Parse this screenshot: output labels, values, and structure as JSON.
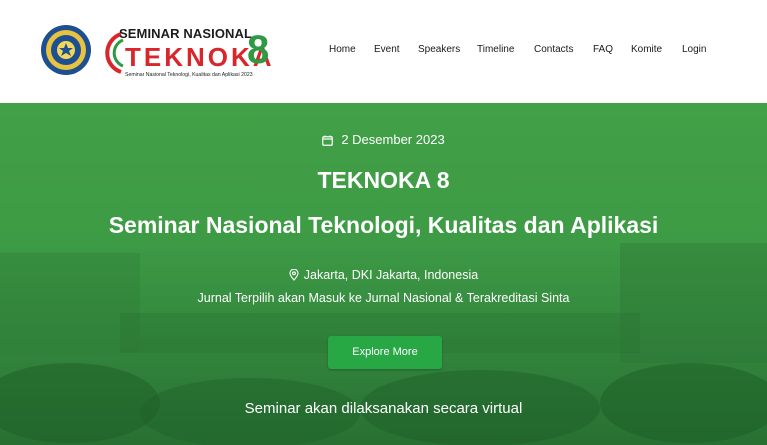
{
  "header": {
    "brand": {
      "top_text": "SEMINAR NASIONAL",
      "name": "TEKNOKA",
      "number": "8",
      "subtitle": "Seminar Nasional Teknologi, Kualitas dan Aplikasi 2023"
    },
    "nav": [
      {
        "label": "Home"
      },
      {
        "label": "Event"
      },
      {
        "label": "Speakers"
      },
      {
        "label": "Timeline"
      },
      {
        "label": "Contacts"
      },
      {
        "label": "FAQ"
      },
      {
        "label": "Komite"
      },
      {
        "label": "Login"
      }
    ]
  },
  "hero": {
    "date": "2 Desember 2023",
    "title": "TEKNOKA 8",
    "subtitle": "Seminar Nasional Teknologi, Kualitas dan Aplikasi",
    "location": "Jakarta, DKI Jakarta, Indonesia",
    "journal_note": "Jurnal Terpilih akan Masuk ke Jurnal Nasional & Terakreditasi Sinta",
    "cta_label": "Explore More",
    "virtual_note": "Seminar akan dilaksanakan secara virtual"
  },
  "colors": {
    "brand_red": "#d8262b",
    "brand_green": "#2e9a43",
    "hero_green": "#43a047",
    "button_green": "#28a745"
  },
  "icons": [
    "university-logo-icon",
    "calendar-icon",
    "map-pin-icon"
  ]
}
